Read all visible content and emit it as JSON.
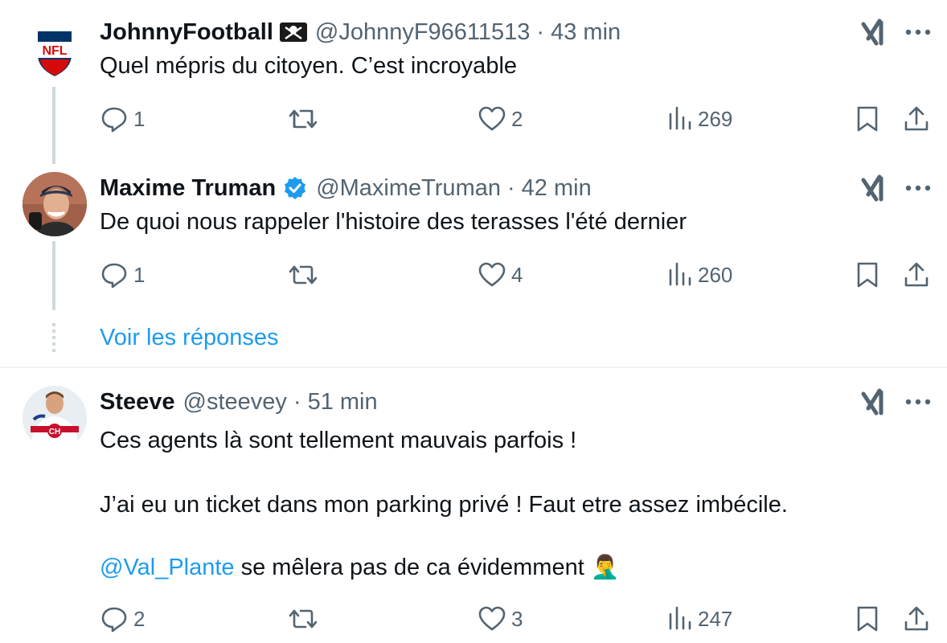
{
  "tweets": [
    {
      "name": "JohnnyFootball",
      "badge": "pirate-flag",
      "handle": "@JohnnyF96611513",
      "dot": "·",
      "time": "43 min",
      "text": "Quel mépris du citoyen.  C’est incroyable",
      "replies": "1",
      "retweets": "",
      "likes": "2",
      "views": "269",
      "avatar": "nfl-logo"
    },
    {
      "name": "Maxime Truman",
      "badge": "verified",
      "handle": "@MaximeTruman",
      "dot": "·",
      "time": "42 min",
      "text": "De quoi nous rappeler l'histoire des terasses l'été dernier",
      "replies": "1",
      "retweets": "",
      "likes": "4",
      "views": "260",
      "avatar": "person-photo"
    },
    {
      "name": "Steeve",
      "badge": "",
      "handle": "@steevey",
      "dot": "·",
      "time": "51 min",
      "text_line1": "Ces agents là sont tellement mauvais parfois !",
      "text_line2": "J’ai eu un ticket dans mon parking privé ! Faut etre assez imbécile.",
      "mention": "@Val_Plante",
      "text_line3_rest": " se mêlera pas de ca évidemment ",
      "emoji": "🤦‍♂️",
      "replies": "2",
      "retweets": "",
      "likes": "3",
      "views": "247",
      "avatar": "hockey-player"
    }
  ],
  "show_replies": "Voir les réponses",
  "colors": {
    "accent": "#1d9bf0",
    "text": "#0f1419",
    "secondary": "#536471",
    "line": "#cfd9de"
  }
}
